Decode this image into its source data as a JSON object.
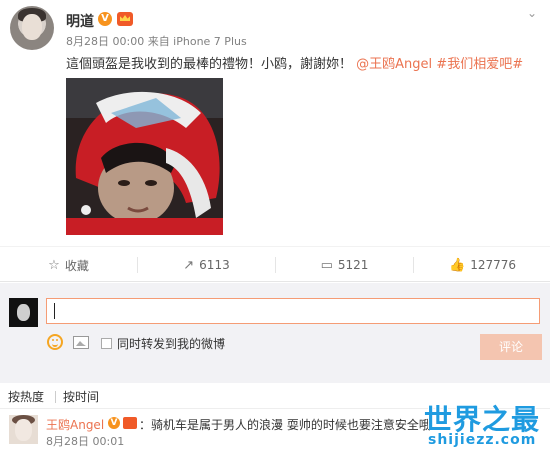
{
  "post": {
    "username": "明道",
    "verified_badge": "V",
    "meta": "8月28日 00:00 来自 iPhone 7 Plus",
    "content_text": "這個頭盔是我收到的最棒的禮物！小鸥，謝謝妳！",
    "mention": "@王鸥Angel",
    "topic": "#我们相爱吧#",
    "icons": {
      "more": "chevron-down-icon",
      "verified": "verified-v-icon",
      "vip": "vip-crown-icon"
    }
  },
  "actions": [
    {
      "icon": "star-icon",
      "label": "收藏"
    },
    {
      "icon": "repost-icon",
      "label": "6113"
    },
    {
      "icon": "comment-icon",
      "label": "5121"
    },
    {
      "icon": "like-icon",
      "label": "127776"
    }
  ],
  "composer": {
    "input_value": "",
    "repost_label": "同时转发到我的微博",
    "submit_label": "评论",
    "icons": {
      "emoji": "emoji-icon",
      "image": "image-icon"
    }
  },
  "sort": {
    "by_hot": "按热度",
    "by_time": "按时间"
  },
  "comments": [
    {
      "username": "王鸥Angel",
      "badge": "V",
      "text": "：骑机车是属于男人的浪漫 耍帅的时候也要注意安全哦",
      "time": "8月28日 00:01"
    }
  ],
  "watermark": {
    "main": "世界之最",
    "sub": "shijiezz.com"
  },
  "colors": {
    "accent": "#eb7350",
    "submit_disabled": "#f4c5b0",
    "watermark": "#1f9be0",
    "badge": "#f7931e"
  }
}
